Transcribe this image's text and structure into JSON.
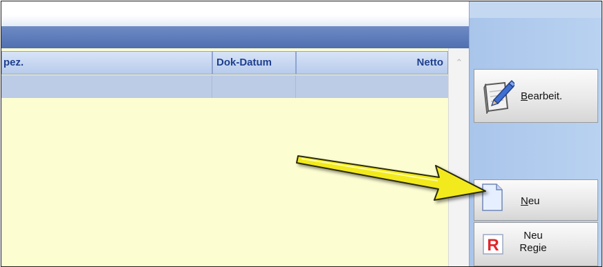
{
  "grid": {
    "columns": [
      {
        "label": "pez."
      },
      {
        "label": "Dok-Datum"
      },
      {
        "label": "Netto"
      }
    ]
  },
  "sidebar": {
    "bearbeit": {
      "underline_char": "B",
      "rest": "earbeit.",
      "icon": "edit-document-icon"
    },
    "neu": {
      "underline_char": "N",
      "rest": "eu",
      "icon": "new-document-icon"
    },
    "neu_regie": {
      "line1": "Neu",
      "line2": "Regie",
      "icon_letter": "R",
      "icon": "regie-r-icon"
    }
  },
  "annotation": {
    "icon": "yellow-arrow",
    "color": "#f2ea1a"
  },
  "colors": {
    "grid_background": "#fdfdd2",
    "header_text": "#1e3f8e",
    "title_bar": "#5a78b8",
    "selected_row": "#bccbe6",
    "side_panel": "#b2cdee"
  }
}
